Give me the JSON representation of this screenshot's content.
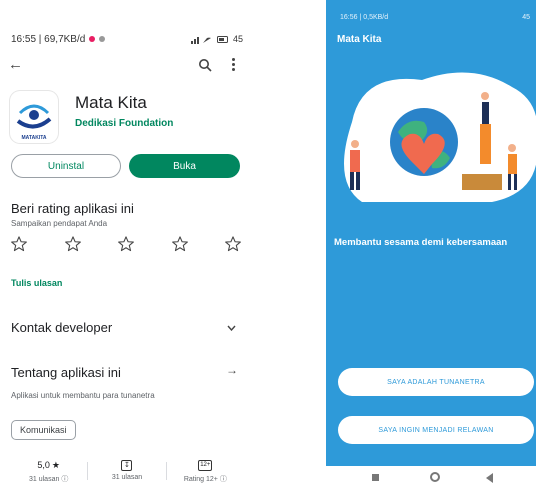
{
  "left": {
    "status_time": "16:55 | 69,7KB/d",
    "status_right": "45",
    "app": {
      "name": "Mata Kita",
      "developer": "Dedikasi Foundation",
      "icon_text": "MATAKITA"
    },
    "buttons": {
      "uninstall": "Uninstal",
      "open": "Buka"
    },
    "rating": {
      "title": "Beri rating aplikasi ini",
      "subtitle": "Sampaikan pendapat Anda",
      "write": "Tulis ulasan"
    },
    "sections": {
      "contact": "Kontak developer",
      "about": "Tentang aplikasi ini"
    },
    "about_desc": "Aplikasi untuk membantu para tunanetra",
    "chip": "Komunikasi",
    "stats": {
      "rating_value": "5,0",
      "rating_sub": "31 ulasan",
      "downloads_sub": "31 ulasan",
      "age_box": "12+",
      "age_sub": "Rating 12+"
    }
  },
  "right": {
    "status_time": "16:56 | 0,5KB/d",
    "status_right": "45",
    "title": "Mata Kita",
    "tagline": "Membantu sesama demi kebersamaan",
    "button_blind": "SAYA ADALAH TUNANETRA",
    "button_volunteer": "SAYA INGIN MENJADI RELAWAN"
  },
  "colors": {
    "play_green": "#01875f",
    "app_blue": "#2e9ad9"
  }
}
